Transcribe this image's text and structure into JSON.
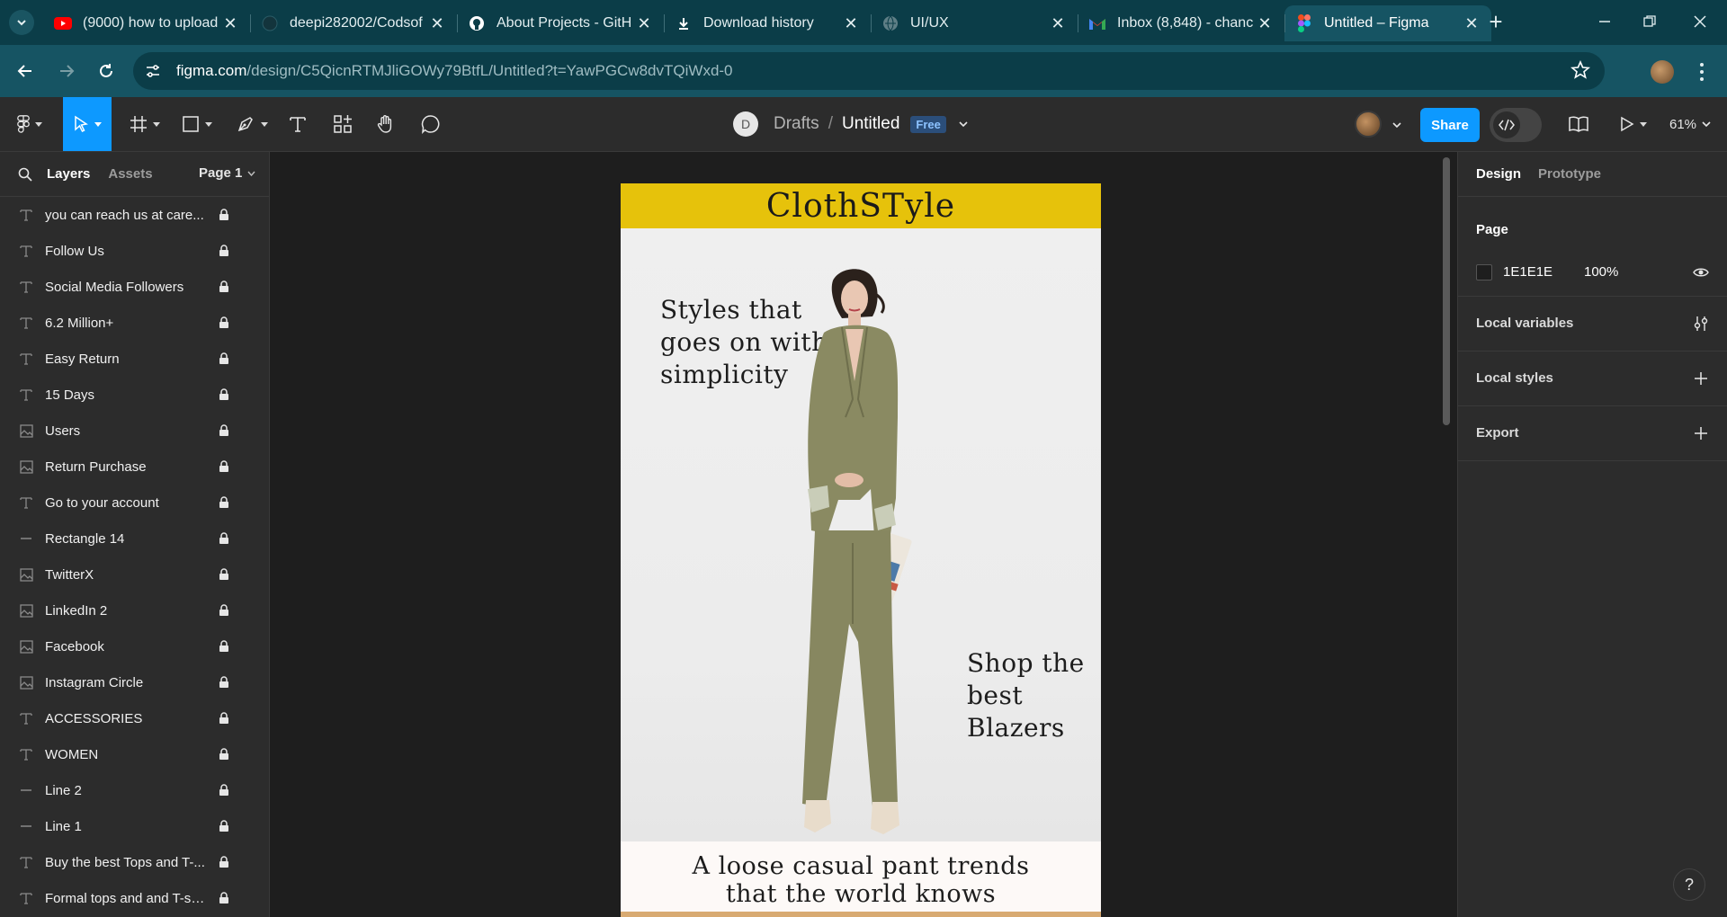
{
  "browser": {
    "tabs": [
      {
        "title": "(9000) how to upload",
        "icon": "youtube-icon"
      },
      {
        "title": "deepi282002/Codsof",
        "icon": "github-icon"
      },
      {
        "title": "About Projects - GitH",
        "icon": "github-icon"
      },
      {
        "title": "Download history",
        "icon": "download-icon"
      },
      {
        "title": "UI/UX",
        "icon": "globe-icon"
      },
      {
        "title": "Inbox (8,848) - chanc",
        "icon": "gmail-icon"
      },
      {
        "title": "Untitled – Figma",
        "icon": "figma-icon",
        "active": true
      }
    ],
    "url_host": "figma.com",
    "url_path": "/design/C5QicnRTMJliGOWy79BtfL/Untitled?t=YawPGCw8dvTQiWxd-0"
  },
  "figma": {
    "team_initial": "D",
    "breadcrumb_folder": "Drafts",
    "breadcrumb_sep": "/",
    "file_name": "Untitled",
    "plan_badge": "Free",
    "share_label": "Share",
    "zoom": "61%"
  },
  "left_panel": {
    "tabs": [
      "Layers",
      "Assets"
    ],
    "page_label": "Page 1",
    "layers": [
      {
        "name": "you can reach us at care...",
        "type": "text"
      },
      {
        "name": "Follow Us",
        "type": "text"
      },
      {
        "name": "Social Media Followers",
        "type": "text"
      },
      {
        "name": "6.2 Million+",
        "type": "text"
      },
      {
        "name": "Easy Return",
        "type": "text"
      },
      {
        "name": "15 Days",
        "type": "text"
      },
      {
        "name": "Users",
        "type": "image"
      },
      {
        "name": "Return Purchase",
        "type": "image"
      },
      {
        "name": "Go to your account",
        "type": "text"
      },
      {
        "name": "Rectangle 14",
        "type": "line"
      },
      {
        "name": "TwitterX",
        "type": "image"
      },
      {
        "name": "LinkedIn 2",
        "type": "image"
      },
      {
        "name": "Facebook",
        "type": "image"
      },
      {
        "name": "Instagram Circle",
        "type": "image"
      },
      {
        "name": "ACCESSORIES",
        "type": "text"
      },
      {
        "name": "WOMEN",
        "type": "text"
      },
      {
        "name": "Line 2",
        "type": "line"
      },
      {
        "name": "Line 1",
        "type": "line"
      },
      {
        "name": "Buy the best Tops and T-...",
        "type": "text"
      },
      {
        "name": "Formal tops and and T-sh...",
        "type": "text"
      }
    ]
  },
  "canvas": {
    "brand": "ClothSTyle",
    "hero_text_1": "Styles that\ngoes on with\nsimplicity",
    "hero_text_2": "Shop the\nbest\nBlazers",
    "bottom_text": "A loose casual pant trends\nthat the world knows",
    "colors": {
      "header": "#E6C20B",
      "suit": "#8A8A62",
      "bottom_strip": "#D8AA72"
    }
  },
  "right_panel": {
    "tabs": [
      "Design",
      "Prototype"
    ],
    "page_title": "Page",
    "page_color": "1E1E1E",
    "page_opacity": "100%",
    "local_variables": "Local variables",
    "local_styles": "Local styles",
    "export": "Export"
  },
  "help_label": "?"
}
